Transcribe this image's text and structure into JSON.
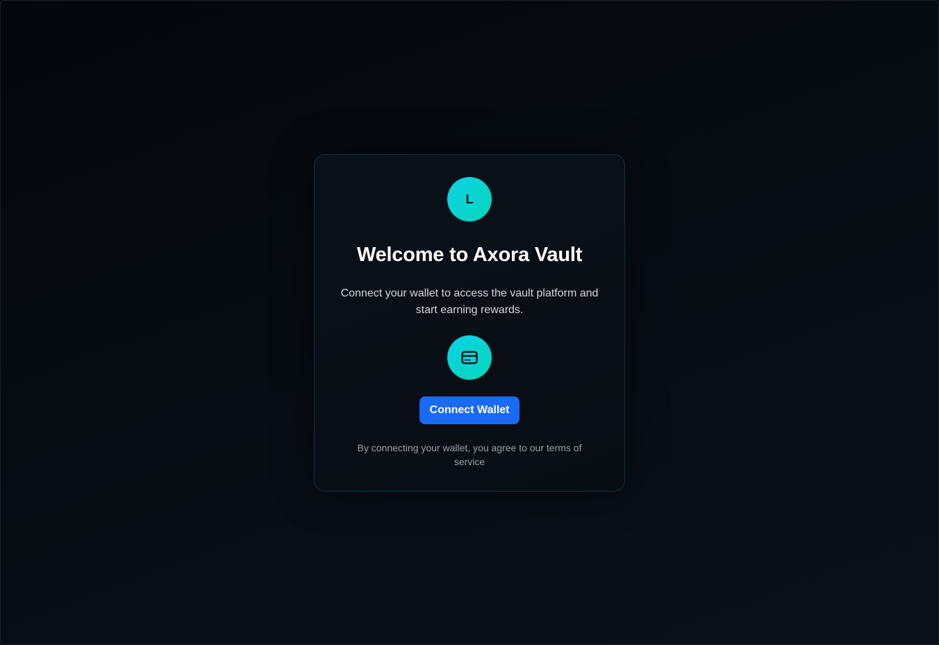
{
  "card": {
    "logo_letter": "L",
    "title": "Welcome to Axora Vault",
    "subtitle": "Connect your wallet to access the vault platform and start earning rewards.",
    "wallet_icon": "wallet-card-icon",
    "connect_button_label": "Connect Wallet",
    "terms_text": "By connecting your wallet, you agree to our terms of service"
  },
  "colors": {
    "accent_gradient_start": "#0bd2e6",
    "accent_gradient_end": "#06d6b9",
    "button": "#1a6af5",
    "background": "#05090e"
  }
}
